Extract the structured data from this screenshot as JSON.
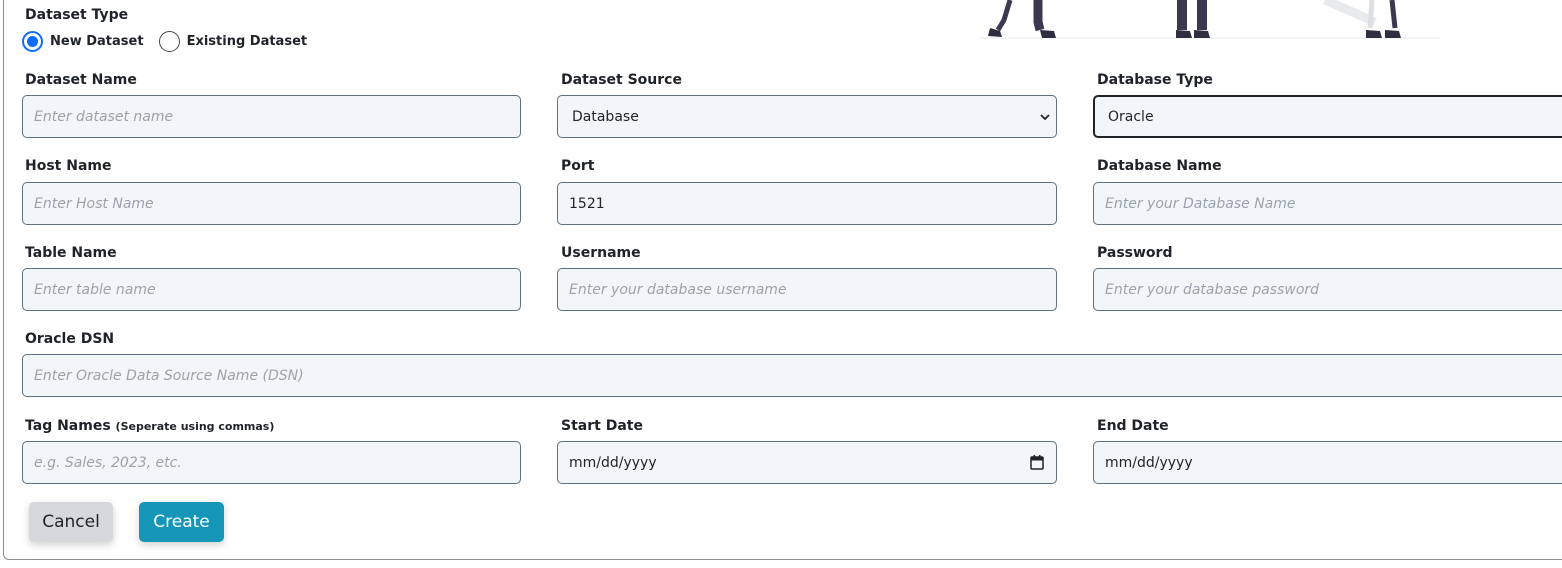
{
  "dataset_type": {
    "label": "Dataset Type",
    "options": [
      {
        "label": "New Dataset",
        "checked": true
      },
      {
        "label": "Existing Dataset",
        "checked": false
      }
    ]
  },
  "fields": {
    "dataset_name": {
      "label": "Dataset Name",
      "placeholder": "Enter dataset name",
      "value": ""
    },
    "dataset_source": {
      "label": "Dataset Source",
      "value": "Database"
    },
    "database_type": {
      "label": "Database Type",
      "value": "Oracle"
    },
    "host_name": {
      "label": "Host Name",
      "placeholder": "Enter Host Name",
      "value": ""
    },
    "port": {
      "label": "Port",
      "value": "1521"
    },
    "database_name": {
      "label": "Database Name",
      "placeholder": "Enter your Database Name",
      "value": ""
    },
    "table_name": {
      "label": "Table Name",
      "placeholder": "Enter table name",
      "value": ""
    },
    "username": {
      "label": "Username",
      "placeholder": "Enter your database username",
      "value": ""
    },
    "password": {
      "label": "Password",
      "placeholder": "Enter your database password",
      "value": ""
    },
    "oracle_dsn": {
      "label": "Oracle DSN",
      "placeholder": "Enter Oracle Data Source Name (DSN)",
      "value": ""
    },
    "tag_names": {
      "label": "Tag Names",
      "hint": "(Seperate using commas)",
      "placeholder": "e.g. Sales, 2023, etc.",
      "value": ""
    },
    "start_date": {
      "label": "Start Date",
      "value": "mm/dd/yyyy"
    },
    "end_date": {
      "label": "End Date",
      "value": "mm/dd/yyyy"
    }
  },
  "actions": {
    "cancel_label": "Cancel",
    "create_label": "Create"
  },
  "colors": {
    "accent": "#0d6efd",
    "create_button": "#1596b8",
    "cancel_button": "#d6d8db",
    "field_background": "#f3f6f8"
  },
  "icons": {
    "select_caret": "chevron-down-icon",
    "date_picker": "calendar-icon"
  }
}
